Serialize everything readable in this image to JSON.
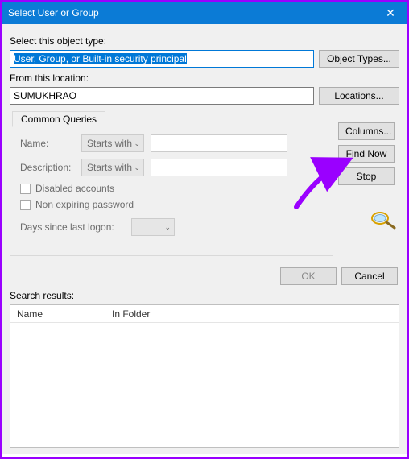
{
  "title": "Select User or Group",
  "objectType": {
    "label": "Select this object type:",
    "value": "User, Group, or Built-in security principal",
    "button": "Object Types..."
  },
  "location": {
    "label": "From this location:",
    "value": "SUMUKHRAO",
    "button": "Locations..."
  },
  "tab": "Common Queries",
  "queries": {
    "nameLabel": "Name:",
    "nameMode": "Starts with",
    "descLabel": "Description:",
    "descMode": "Starts with",
    "disabled": "Disabled accounts",
    "nonExpire": "Non expiring password",
    "daysLabel": "Days since last logon:"
  },
  "buttons": {
    "columns": "Columns...",
    "findNow": "Find Now",
    "stop": "Stop",
    "ok": "OK",
    "cancel": "Cancel"
  },
  "results": {
    "label": "Search results:",
    "col1": "Name",
    "col2": "In Folder"
  }
}
